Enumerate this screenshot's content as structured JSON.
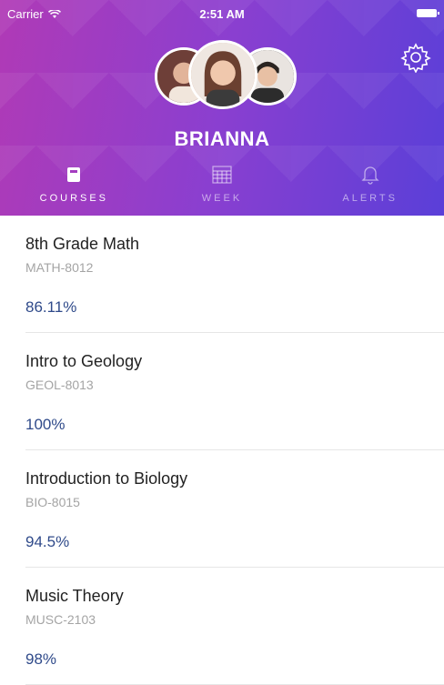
{
  "status_bar": {
    "carrier": "Carrier",
    "time": "2:51 AM"
  },
  "header": {
    "student_name": "BRIANNA",
    "gradient_start": "#b03ab6",
    "gradient_end": "#5a3fd8"
  },
  "tabs": [
    {
      "label": "COURSES",
      "icon": "course-book-icon",
      "active": true
    },
    {
      "label": "WEEK",
      "icon": "calendar-icon",
      "active": false
    },
    {
      "label": "ALERTS",
      "icon": "bell-icon",
      "active": false
    }
  ],
  "courses": [
    {
      "title": "8th Grade Math",
      "code": "MATH-8012",
      "grade": "86.11%"
    },
    {
      "title": "Intro to Geology",
      "code": "GEOL-8013",
      "grade": "100%"
    },
    {
      "title": "Introduction to Biology",
      "code": "BIO-8015",
      "grade": "94.5%"
    },
    {
      "title": "Music Theory",
      "code": "MUSC-2103",
      "grade": "98%"
    }
  ],
  "colors": {
    "grade_text": "#2f4a8a",
    "code_text": "#a4a4a4"
  }
}
